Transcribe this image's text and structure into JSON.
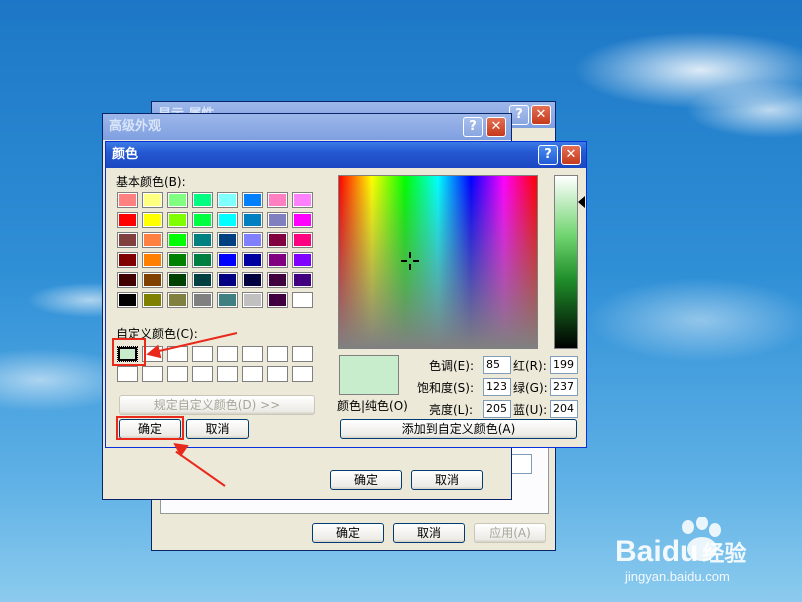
{
  "back_window": {
    "title": "显示 属性",
    "buttons": {
      "ok": "确定",
      "cancel": "取消",
      "apply": "应用(A)"
    }
  },
  "advanced_window": {
    "title": "高级外观",
    "buttons": {
      "ok": "确定",
      "cancel": "取消"
    }
  },
  "color_dialog": {
    "title": "颜色",
    "basic_colors_label": "基本颜色(B):",
    "custom_colors_label": "自定义颜色(C):",
    "define_custom_button": "规定自定义颜色(D) >>",
    "ok_button": "确定",
    "cancel_button": "取消",
    "add_custom_button": "添加到自定义颜色(A)",
    "color_solid_label": "颜色|纯色(O)",
    "fields": {
      "hue": {
        "label": "色调(E):",
        "value": "85"
      },
      "sat": {
        "label": "饱和度(S):",
        "value": "123"
      },
      "lum": {
        "label": "亮度(L):",
        "value": "205"
      },
      "red": {
        "label": "红(R):",
        "value": "199"
      },
      "green": {
        "label": "绿(G):",
        "value": "237"
      },
      "blue": {
        "label": "蓝(U):",
        "value": "204"
      }
    },
    "basic_colors": [
      "#ff8080",
      "#ffff80",
      "#80ff80",
      "#00ff80",
      "#80ffff",
      "#0080ff",
      "#ff80c0",
      "#ff80ff",
      "#ff0000",
      "#ffff00",
      "#80ff00",
      "#00ff40",
      "#00ffff",
      "#0080c0",
      "#8080c0",
      "#ff00ff",
      "#804040",
      "#ff8040",
      "#00ff00",
      "#008080",
      "#004080",
      "#8080ff",
      "#800040",
      "#ff0080",
      "#800000",
      "#ff8000",
      "#008000",
      "#008040",
      "#0000ff",
      "#0000a0",
      "#800080",
      "#8000ff",
      "#400000",
      "#804000",
      "#004000",
      "#004040",
      "#000080",
      "#000040",
      "#400040",
      "#400080",
      "#000000",
      "#808000",
      "#808040",
      "#808080",
      "#408080",
      "#c0c0c0",
      "#400040",
      "#ffffff"
    ],
    "custom_colors": [
      "#c7edcc",
      "#ffffff",
      "#ffffff",
      "#ffffff",
      "#ffffff",
      "#ffffff",
      "#ffffff",
      "#ffffff",
      "#ffffff",
      "#ffffff",
      "#ffffff",
      "#ffffff",
      "#ffffff",
      "#ffffff",
      "#ffffff",
      "#ffffff"
    ],
    "selected_color": "#c7edcc"
  },
  "watermark": {
    "brand": "Bai",
    "brand_2": "du",
    "suffix": "经验",
    "url": "jingyan.baidu.com"
  }
}
